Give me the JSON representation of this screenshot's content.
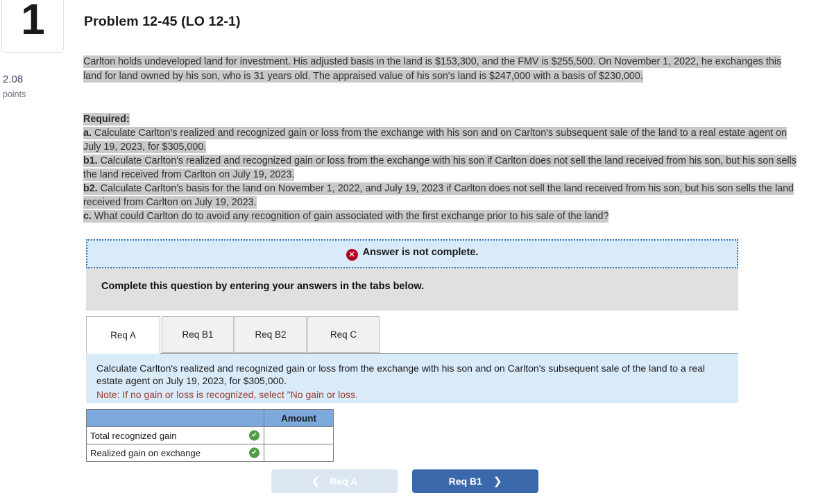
{
  "question": {
    "number": "1",
    "points_value": "2.08",
    "points_label": "points",
    "title": "Problem 12-45 (LO 12-1)"
  },
  "stem": {
    "text": "Carlton holds undeveloped land for investment. His adjusted basis in the land is $153,300, and the FMV is $255,500. On November 1, 2022, he exchanges this land for land owned by his son, who is 31 years old. The appraised value of his son's land is $247,000 with a basis of $230,000."
  },
  "required": {
    "heading": "Required:",
    "items": [
      {
        "marker": "a.",
        "text": "Calculate Carlton's realized and recognized gain or loss from the exchange with his son and on Carlton's subsequent sale of the land to a real estate agent on July 19, 2023, for $305,000."
      },
      {
        "marker": "b1.",
        "text": "Calculate Carlton's realized and recognized gain or loss from the exchange with his son if Carlton does not sell the land received from his son, but his son sells the land received from Carlton on July 19, 2023."
      },
      {
        "marker": "b2.",
        "text": "Calculate Carlton's basis for the land on November 1, 2022, and July 19, 2023 if Carlton does not sell the land received from his son, but his son sells the land received from Carlton on July 19, 2023."
      },
      {
        "marker": "c.",
        "text": "What could Carlton do to avoid any recognition of gain associated with the first exchange prior to his sale of the land?"
      }
    ]
  },
  "alert": {
    "icon": "error-x-icon",
    "text": "Answer is not complete.",
    "icon_glyph": "✕",
    "color": "#b00020"
  },
  "instruction": {
    "text": "Complete this question by entering your answers in the tabs below."
  },
  "tabs": [
    {
      "label": "Req A",
      "active": true
    },
    {
      "label": "Req B1",
      "active": false
    },
    {
      "label": "Req B2",
      "active": false
    },
    {
      "label": "Req C",
      "active": false
    }
  ],
  "req_panel": {
    "text": "Calculate Carlton's realized and recognized gain or loss from the exchange with his son and on Carlton's subsequent sale of the land to a real estate agent on July 19, 2023, for $305,000.",
    "note": "Note: If no gain or loss is recognized, select \"No gain or loss.",
    "background": "#d9eaf8",
    "note_color": "#9c3c2f"
  },
  "answer_table": {
    "header_label": "",
    "amount_header": "Amount",
    "header_color": "#7ea9dc",
    "check_glyph": "✔",
    "check_color": "#4f9c44",
    "rows": [
      {
        "label": "Total recognized gain",
        "status": "complete-check-icon",
        "amount": ""
      },
      {
        "label": "Realized gain on exchange",
        "status": "complete-check-icon",
        "amount": ""
      }
    ]
  },
  "nav": {
    "prev_label": "Req A",
    "prev_chevron": "❮",
    "next_label": "Req B1",
    "next_chevron": "❯",
    "prev_color": "#dce6f2",
    "next_color": "#3a69ab"
  }
}
